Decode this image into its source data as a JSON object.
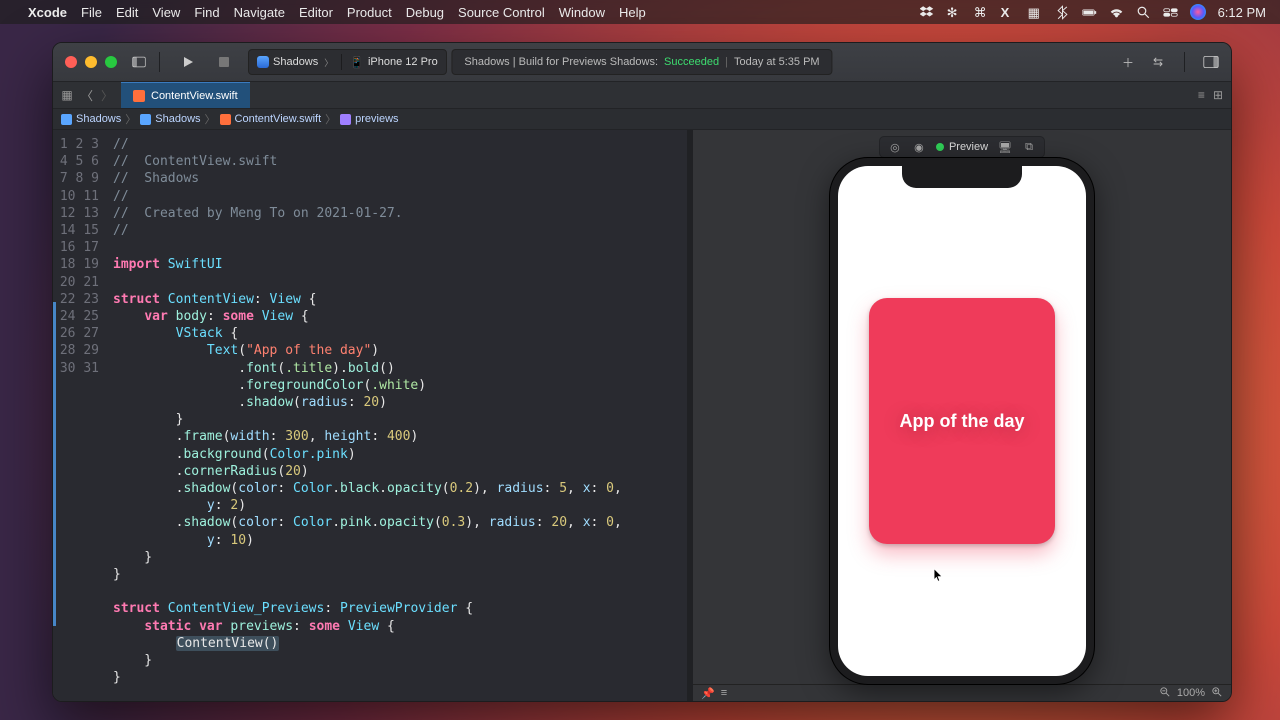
{
  "menubar": {
    "app": "Xcode",
    "items": [
      "File",
      "Edit",
      "View",
      "Find",
      "Navigate",
      "Editor",
      "Product",
      "Debug",
      "Source Control",
      "Window",
      "Help"
    ],
    "wifi_percent": "100%",
    "clock": "6:12 PM"
  },
  "titlebar": {
    "scheme_target": "Shadows",
    "scheme_device": "iPhone 12 Pro",
    "activity_prefix": "Shadows | Build for Previews Shadows:",
    "activity_status": "Succeeded",
    "activity_time": "Today at 5:35 PM"
  },
  "tab": {
    "filename": "ContentView.swift"
  },
  "breadcrumb": {
    "items": [
      "Shadows",
      "Shadows",
      "ContentView.swift",
      "previews"
    ]
  },
  "code": {
    "lines": 31,
    "comment_header": [
      "//",
      "//  ContentView.swift",
      "//  Shadows",
      "//",
      "//  Created by Meng To on 2021-01-27.",
      "//"
    ],
    "import_kw": "import",
    "import_module": "SwiftUI",
    "struct_name": "ContentView",
    "previews_struct": "ContentView_Previews",
    "preview_provider": "PreviewProvider",
    "view_type": "View",
    "body_var": "body",
    "some_kw": "some",
    "text_literal": "\"App of the day\"",
    "font_title": ".title",
    "fg_white": ".white",
    "shadow_radius1": "20",
    "frame_w": "300",
    "frame_h": "400",
    "bg_color": "Color.pink",
    "corner_radius": "20",
    "s2_op": "0.2",
    "s2_r": "5",
    "s2_x": "0",
    "s2_y": "2",
    "s3_op": "0.3",
    "s3_r": "20",
    "s3_x": "0",
    "s3_y": "10",
    "previews_var": "previews",
    "call": "ContentView()"
  },
  "preview": {
    "label": "Preview",
    "card_text": "App of the day",
    "zoom": "100%"
  }
}
